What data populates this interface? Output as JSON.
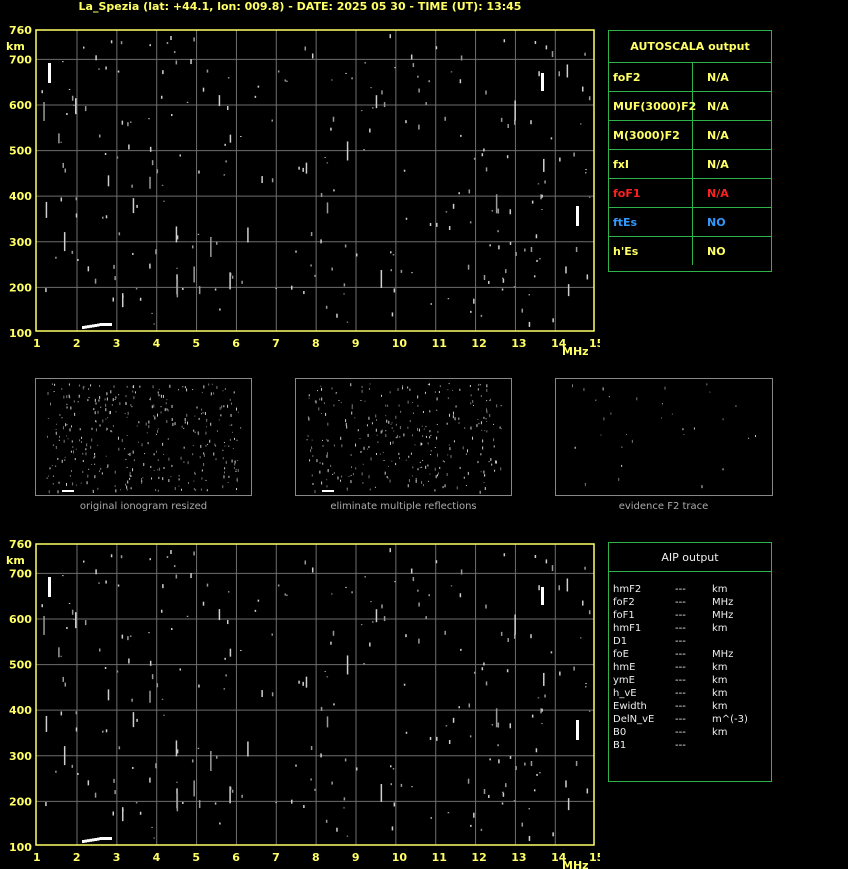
{
  "header": {
    "title": "La_Spezia (lat: +44.1, lon: 009.8) - DATE: 2025 05 30 - TIME (UT): 13:45"
  },
  "ionogram": {
    "y_unit": "km",
    "x_unit": "MHz",
    "y_ticks": [
      "760",
      "700",
      "600",
      "500",
      "400",
      "300",
      "200",
      "100"
    ],
    "x_ticks": [
      "1",
      "2",
      "3",
      "4",
      "5",
      "6",
      "7",
      "8",
      "9",
      "10",
      "11",
      "12",
      "13",
      "14",
      "15"
    ]
  },
  "autoscala": {
    "title": "AUTOSCALA output",
    "rows": [
      {
        "key": "foF2",
        "value": "N/A",
        "color": "#ffff66"
      },
      {
        "key": "MUF(3000)F2",
        "value": "N/A",
        "color": "#ffff66"
      },
      {
        "key": "M(3000)F2",
        "value": "N/A",
        "color": "#ffff66"
      },
      {
        "key": "fxI",
        "value": "N/A",
        "color": "#ffff66"
      },
      {
        "key": "foF1",
        "value": "N/A",
        "color": "#ff2020"
      },
      {
        "key": "ftEs",
        "value": "NO",
        "color": "#3399ff"
      },
      {
        "key": "h'Es",
        "value": "NO",
        "color": "#ffff66"
      }
    ]
  },
  "thumbnails": [
    {
      "caption": "original ionogram resized"
    },
    {
      "caption": "eliminate multiple reflections"
    },
    {
      "caption": "evidence F2 trace"
    }
  ],
  "aip": {
    "title": "AIP output",
    "rows": [
      {
        "key": "hmF2",
        "value": "---",
        "unit": "km"
      },
      {
        "key": "foF2",
        "value": "---",
        "unit": "MHz"
      },
      {
        "key": "foF1",
        "value": "---",
        "unit": "MHz"
      },
      {
        "key": "hmF1",
        "value": "---",
        "unit": "km"
      },
      {
        "key": "D1",
        "value": "---",
        "unit": ""
      },
      {
        "key": "foE",
        "value": "---",
        "unit": "MHz"
      },
      {
        "key": "hmE",
        "value": "---",
        "unit": "km"
      },
      {
        "key": "ymE",
        "value": "---",
        "unit": "km"
      },
      {
        "key": "h_vE",
        "value": "---",
        "unit": "km"
      },
      {
        "key": "Ewidth",
        "value": "---",
        "unit": "km"
      },
      {
        "key": "DelN_vE",
        "value": "---",
        "unit": "m^(-3)"
      },
      {
        "key": "B0",
        "value": "---",
        "unit": "km"
      },
      {
        "key": "B1",
        "value": "---",
        "unit": ""
      }
    ]
  }
}
